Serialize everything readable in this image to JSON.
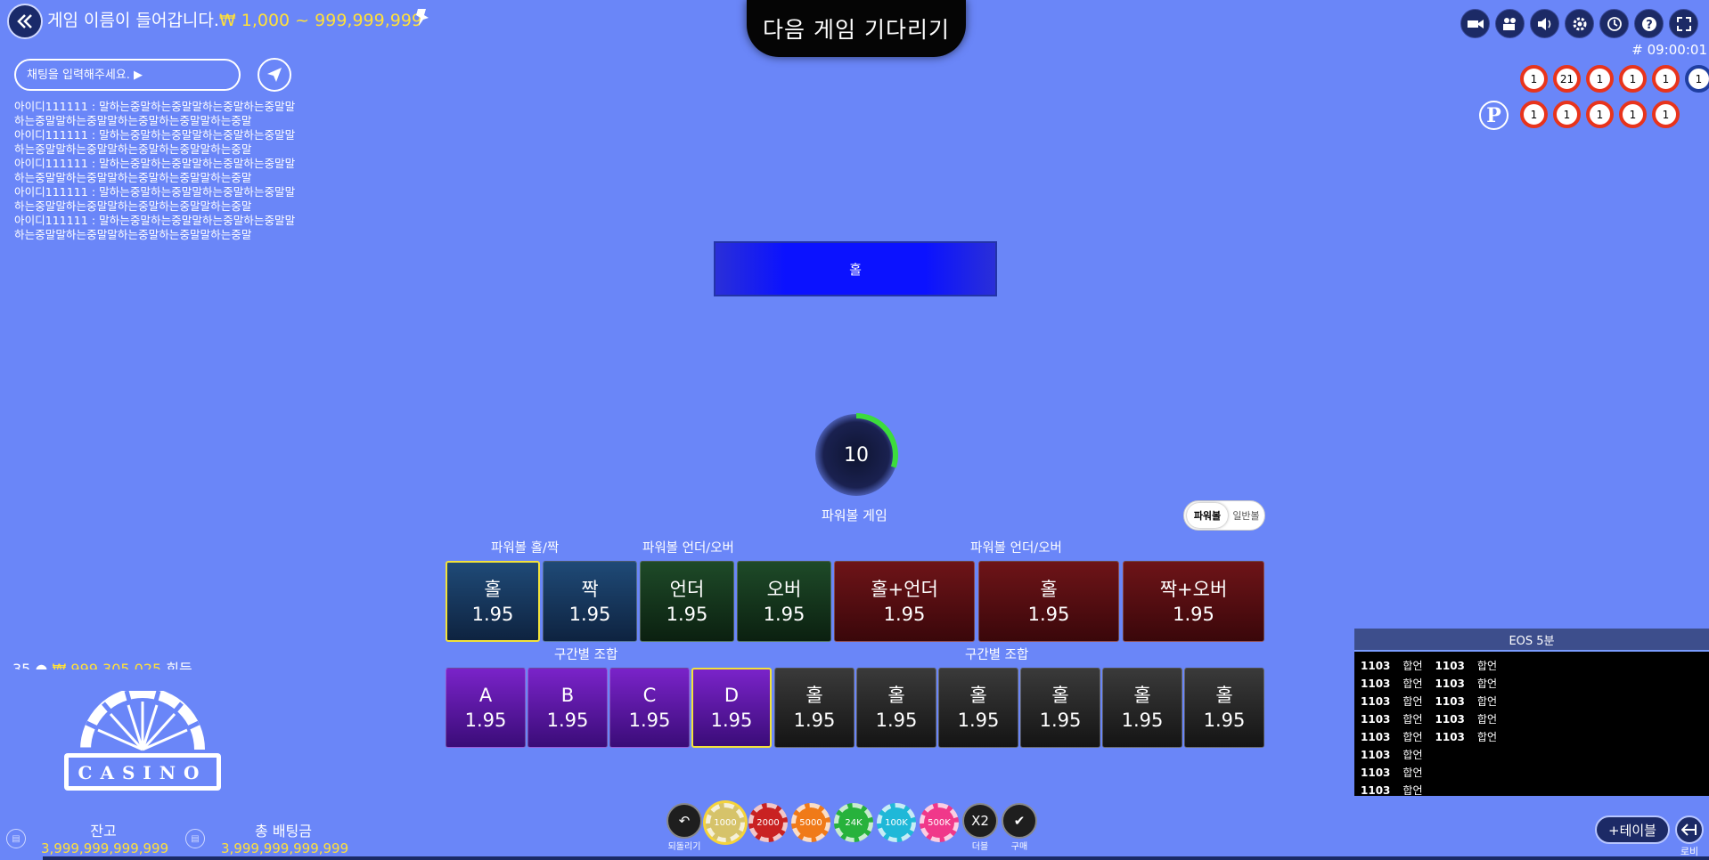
{
  "header": {
    "title": "게임 이름이 들어갑니다.",
    "range": "₩ 1,000 ~ 999,999,999",
    "wait_banner": "다음 게임 기다리기",
    "round_no": "# 09:00:01"
  },
  "chat": {
    "placeholder": "채팅을 입력해주세요. ▶",
    "messages": [
      "아이디111111 : 말하는중말하는중말말하는중말하는중말말하는중말말하는중말말하는중말하는중말말하는중말",
      "아이디111111 : 말하는중말하는중말말하는중말하는중말말하는중말말하는중말말하는중말하는중말말하는중말",
      "아이디111111 : 말하는중말하는중말말하는중말하는중말말하는중말말하는중말말하는중말하는중말말하는중말",
      "아이디111111 : 말하는중말하는중말말하는중말하는중말말하는중말말하는중말말하는중말하는중말말하는중말",
      "아이디111111 : 말하는중말하는중말말하는중말하는중말말하는중말말하는중말말하는중말하는중말말하는중말"
    ]
  },
  "toolbar": [
    "camera-icon",
    "video-icon",
    "sound-icon",
    "settings-icon",
    "history-icon",
    "help-icon",
    "fullscreen-icon"
  ],
  "balls_top": [
    "1",
    "21",
    "1",
    "1",
    "1",
    "1"
  ],
  "balls_bottom": [
    "1",
    "1",
    "1",
    "1",
    "1"
  ],
  "power_badge": "P",
  "result": "홀",
  "timer": {
    "seconds": "10",
    "fraction": 0.3,
    "label": "파워볼 게임"
  },
  "toggle": {
    "on": "파워볼",
    "off": "일반볼"
  },
  "bet_headers": {
    "h1": "파워볼 홀/짝",
    "h2": "파워볼 언더/오버",
    "h3": "파워볼 언더/오버",
    "h4": "구간별 조합",
    "h5": "구간별 조합"
  },
  "bets_row1": [
    {
      "label": "홀",
      "odds": "1.95"
    },
    {
      "label": "짝",
      "odds": "1.95"
    },
    {
      "label": "언더",
      "odds": "1.95"
    },
    {
      "label": "오버",
      "odds": "1.95"
    },
    {
      "label": "홀+언더",
      "odds": "1.95"
    },
    {
      "label": "홀",
      "odds": "1.95"
    },
    {
      "label": "짝+오버",
      "odds": "1.95"
    }
  ],
  "bets_row2": [
    {
      "label": "A",
      "odds": "1.95"
    },
    {
      "label": "B",
      "odds": "1.95"
    },
    {
      "label": "C",
      "odds": "1.95"
    },
    {
      "label": "D",
      "odds": "1.95"
    },
    {
      "label": "홀",
      "odds": "1.95"
    },
    {
      "label": "홀",
      "odds": "1.95"
    },
    {
      "label": "홀",
      "odds": "1.95"
    },
    {
      "label": "홀",
      "odds": "1.95"
    },
    {
      "label": "홀",
      "odds": "1.95"
    },
    {
      "label": "홀",
      "odds": "1.95"
    }
  ],
  "cut_line": {
    "num": "35",
    "amount": "₩ 999,305,025",
    "suffix": "회득"
  },
  "logo_text": "CASINO",
  "balance": {
    "label": "잔고",
    "value": "3,999,999,999,999"
  },
  "total_bet": {
    "label": "총 배팅금",
    "value": "3,999,999,999,999"
  },
  "chips": {
    "undo": "되돌리기",
    "values": [
      "1000",
      "2000",
      "5000",
      "24K",
      "100K",
      "500K"
    ],
    "colors": [
      "#d6c36a",
      "#c92222",
      "#f07a18",
      "#27b23c",
      "#1fb8d8",
      "#f0388a"
    ],
    "double": "X2",
    "double_label": "더블",
    "buy_label": "구매"
  },
  "eos": {
    "title": "EOS 5분",
    "col1": [
      {
        "num": "1103",
        "text": "합언"
      },
      {
        "num": "1103",
        "text": "합언"
      },
      {
        "num": "1103",
        "text": "합언"
      },
      {
        "num": "1103",
        "text": "합언"
      },
      {
        "num": "1103",
        "text": "합언"
      },
      {
        "num": "1103",
        "text": "합언"
      },
      {
        "num": "1103",
        "text": "합언"
      },
      {
        "num": "1103",
        "text": "합언"
      }
    ],
    "col2": [
      {
        "num": "1103",
        "text": "합언"
      },
      {
        "num": "1103",
        "text": "합언"
      },
      {
        "num": "1103",
        "text": "합언"
      },
      {
        "num": "1103",
        "text": "합언"
      },
      {
        "num": "1103",
        "text": "합언"
      }
    ]
  },
  "add_table": "+테이블",
  "lobby": "로비"
}
